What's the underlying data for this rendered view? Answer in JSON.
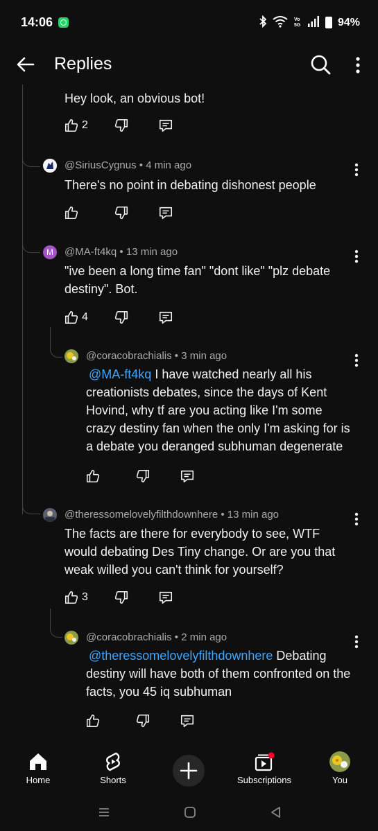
{
  "status_bar": {
    "time": "14:06",
    "battery": "94%",
    "icons": [
      "whatsapp-icon",
      "bluetooth-icon",
      "wifi-icon",
      "volte-icon",
      "signal-icon",
      "battery-icon"
    ]
  },
  "app_bar": {
    "title": "Replies",
    "icons": [
      "back-arrow-icon",
      "search-icon",
      "more-vert-icon"
    ]
  },
  "comments": [
    {
      "body": "Hey look, an obvious bot!",
      "likes": "2"
    },
    {
      "handle": "@SiriusCygnus",
      "time": "4 min ago",
      "body": "There's no point in debating dishonest people",
      "likes": ""
    },
    {
      "handle": "@MA-ft4kq",
      "avatar_letter": "M",
      "time": "13 min ago",
      "body": "\"ive been a long time fan\" \"dont like\" \"plz debate destiny\". Bot.",
      "likes": "4"
    },
    {
      "handle": "@coracobrachialis",
      "time": "3 min ago",
      "mention": "@MA-ft4kq",
      "body": "I have watched nearly all his creationists debates, since the days of Kent Hovind, why tf are you acting like I'm some crazy destiny fan when the only I'm asking for is a debate you deranged subhuman degenerate",
      "likes": ""
    },
    {
      "handle": "@theressomelovelyfilthdownhere",
      "time": "13 min ago",
      "body": "The facts are there for everybody to see, WTF would debating Des Tiny change. Or are you that weak willed you can't think for yourself?",
      "likes": "3"
    },
    {
      "handle": "@coracobrachialis",
      "time": "2 min ago",
      "mention": "@theressomelovelyfilthdownhere",
      "body": "Debating destiny will have both of them confronted on the facts, you 45 iq subhuman",
      "likes": ""
    }
  ],
  "meta_separator": "•",
  "bottom_nav": {
    "items": [
      {
        "label": "Home",
        "icon": "home-icon"
      },
      {
        "label": "Shorts",
        "icon": "shorts-icon"
      },
      {
        "label": "",
        "icon": "create-plus-icon"
      },
      {
        "label": "Subscriptions",
        "icon": "subscriptions-icon"
      },
      {
        "label": "You",
        "icon": "avatar"
      }
    ]
  },
  "colors": {
    "background": "#0f0f0f",
    "text": "#f1f1f1",
    "meta": "#aaaaaa",
    "mention": "#3ea6ff",
    "avatar_M": "#a454c8",
    "notification_dot": "#ff0033"
  }
}
